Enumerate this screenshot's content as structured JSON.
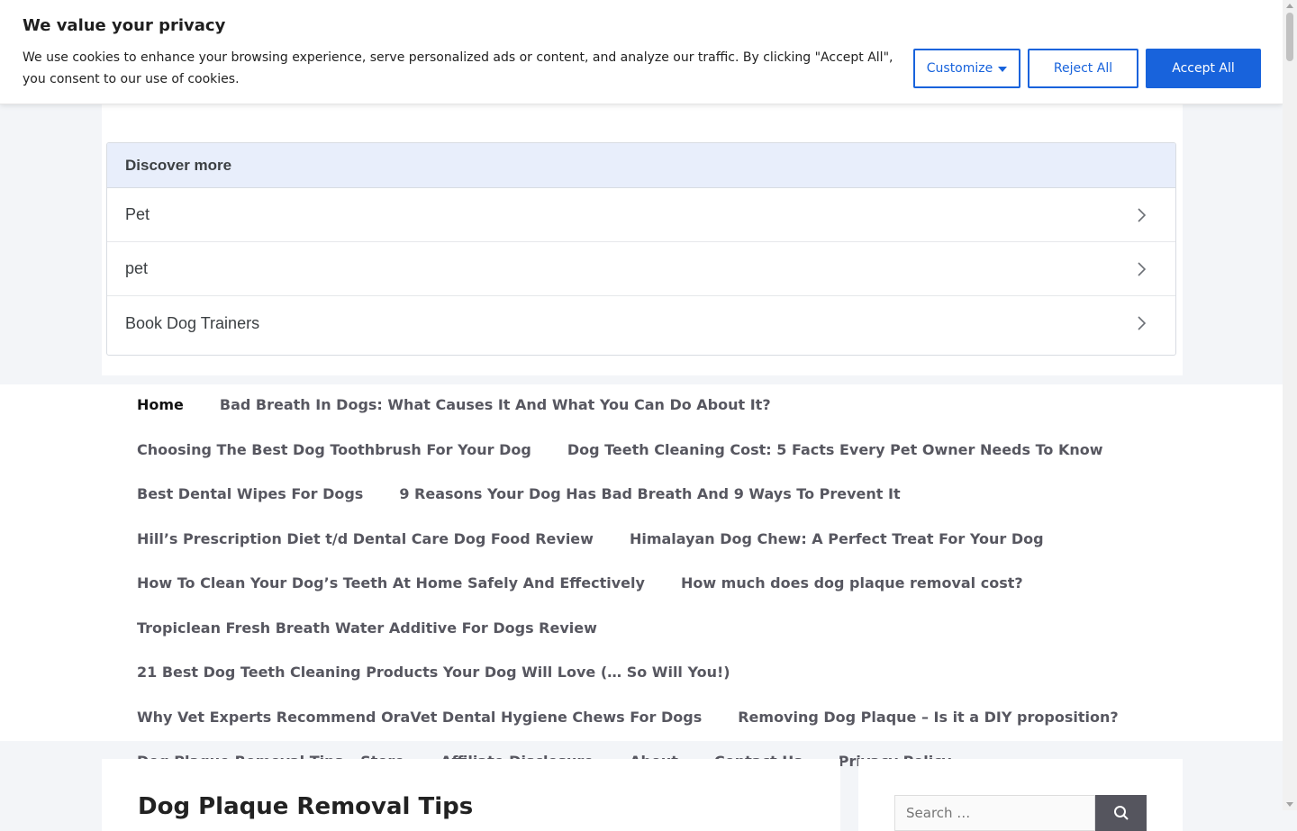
{
  "cookie": {
    "title": "We value your privacy",
    "text": "We use cookies to enhance your browsing experience, serve personalized ads or content, and analyze our traffic. By clicking \"Accept All\", you consent to our use of cookies.",
    "customize_label": "Customize",
    "reject_label": "Reject All",
    "accept_label": "Accept All",
    "accent": "#1863dc"
  },
  "discover": {
    "heading": "Discover more",
    "items": [
      {
        "label": "Pet",
        "icon": "chevron-right-icon"
      },
      {
        "label": "pet",
        "icon": "chevron-right-icon"
      },
      {
        "label": "Book Dog Trainers",
        "icon": "chevron-right-icon"
      }
    ]
  },
  "nav": {
    "items": [
      "Home",
      "Bad Breath In Dogs: What Causes It And What You Can Do About It?",
      "Choosing The Best Dog Toothbrush For Your Dog",
      "Dog Teeth Cleaning Cost: 5 Facts Every Pet Owner Needs To Know",
      "Best Dental Wipes For Dogs",
      "9 Reasons Your Dog Has Bad Breath And 9 Ways To Prevent It",
      "Hill’s Prescription Diet t/d Dental Care Dog Food Review",
      "Himalayan Dog Chew: A Perfect Treat For Your Dog",
      "How To Clean Your Dog’s Teeth At Home Safely And Effectively",
      "How much does dog plaque removal cost?",
      "Tropiclean Fresh Breath Water Additive For Dogs Review",
      "21 Best Dog Teeth Cleaning Products Your Dog Will Love (… So Will You!)",
      "Why Vet Experts Recommend OraVet Dental Hygiene Chews For Dogs",
      "Removing Dog Plaque – Is it a DIY proposition?",
      "Dog Plaque Removal Tips – Store",
      "Affiliate Disclosure",
      "About",
      "Contact Us",
      "Privacy Policy"
    ]
  },
  "main": {
    "title": "Dog Plaque Removal Tips"
  },
  "sidebar": {
    "search_placeholder": "Search …",
    "search_icon": "search-icon"
  }
}
